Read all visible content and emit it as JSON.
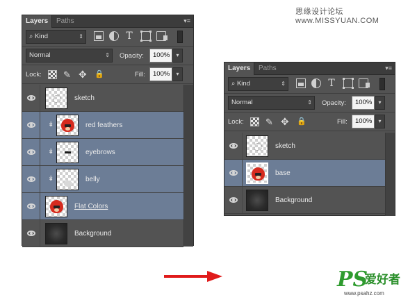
{
  "watermark": {
    "text": "思缘设计论坛 www.MISSYUAN.COM"
  },
  "panels": [
    {
      "tabs": [
        "Layers",
        "Paths"
      ],
      "filter": {
        "value": "Kind",
        "icons": [
          "image-filter-icon",
          "adjustment-filter-icon",
          "type-filter-icon",
          "shape-filter-icon",
          "smart-object-filter-icon"
        ]
      },
      "blend": {
        "value": "Normal"
      },
      "opacity": {
        "label": "Opacity:",
        "value": "100%"
      },
      "lock": {
        "label": "Lock:"
      },
      "fill": {
        "label": "Fill:",
        "value": "100%"
      },
      "layers": [
        {
          "name": "sketch",
          "thumb": "sketch",
          "clipped": false,
          "selected": false
        },
        {
          "name": "red feathers",
          "thumb": "red-bird",
          "clipped": true,
          "selected": true
        },
        {
          "name": "eyebrows",
          "thumb": "eyebrows",
          "clipped": true,
          "selected": true
        },
        {
          "name": "belly",
          "thumb": "belly",
          "clipped": true,
          "selected": true
        },
        {
          "name": "Flat Colors",
          "thumb": "red-bird",
          "clipped": false,
          "selected": true,
          "underline": true
        },
        {
          "name": "Background",
          "thumb": "dark",
          "clipped": false,
          "selected": false
        }
      ]
    },
    {
      "tabs": [
        "Layers",
        "Paths"
      ],
      "filter": {
        "value": "Kind",
        "icons": [
          "image-filter-icon",
          "adjustment-filter-icon",
          "type-filter-icon",
          "shape-filter-icon",
          "smart-object-filter-icon"
        ]
      },
      "blend": {
        "value": "Normal"
      },
      "opacity": {
        "label": "Opacity:",
        "value": "100%"
      },
      "lock": {
        "label": "Lock:"
      },
      "fill": {
        "label": "Fill:",
        "value": "100%"
      },
      "layers": [
        {
          "name": "sketch",
          "thumb": "sketch",
          "clipped": false,
          "selected": false
        },
        {
          "name": "base",
          "thumb": "red-bird",
          "clipped": false,
          "selected": true
        },
        {
          "name": "Background",
          "thumb": "dark",
          "clipped": false,
          "selected": false
        }
      ]
    }
  ],
  "logo": {
    "mark": "PS",
    "chinese": "爱好者",
    "url": "www.psahz.com"
  },
  "colors": {
    "panel": "#535353",
    "selected_row": "#6c7d96",
    "arrow": "#e01b1b",
    "logo": "#2e9b2e"
  }
}
